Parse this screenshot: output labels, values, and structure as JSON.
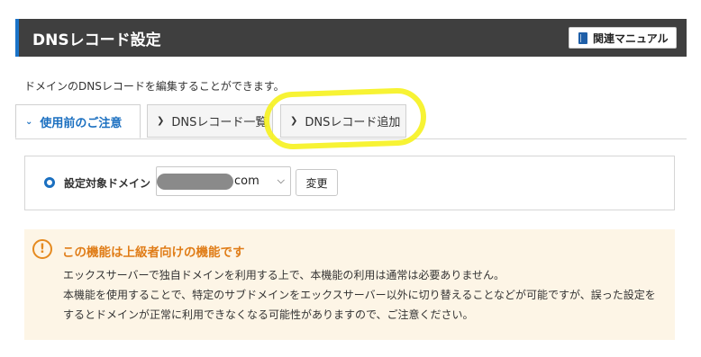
{
  "header": {
    "title": "DNSレコード設定",
    "manual_label": "関連マニュアル"
  },
  "description": "ドメインのDNSレコードを編集することができます。",
  "tabs": [
    {
      "label": "使用前のご注意",
      "icon": "chevron-down-icon",
      "active": true
    },
    {
      "label": "DNSレコード一覧",
      "icon": "chevron-right-icon",
      "active": false
    },
    {
      "label": "DNSレコード追加",
      "icon": "chevron-right-icon",
      "active": false
    }
  ],
  "domain": {
    "label": "設定対象ドメイン",
    "selected_suffix": "com",
    "change_label": "変更"
  },
  "notice": {
    "title": "この機能は上級者向けの機能です",
    "lines": [
      "エックスサーバーで独自ドメインを利用する上で、本機能の利用は通常は必要ありません。",
      "本機能を使用することで、特定のサブドメインをエックスサーバー以外に切り替えることなどが可能ですが、誤った設定をするとドメインが正常に利用できなくなる可能性がありますので、ご注意ください。"
    ]
  },
  "colors": {
    "header_bg": "#3f3f3f",
    "accent": "#1a6fc0",
    "warning": "#e07d18",
    "notice_bg": "#fdf5e6",
    "highlight": "#f6f21e"
  }
}
